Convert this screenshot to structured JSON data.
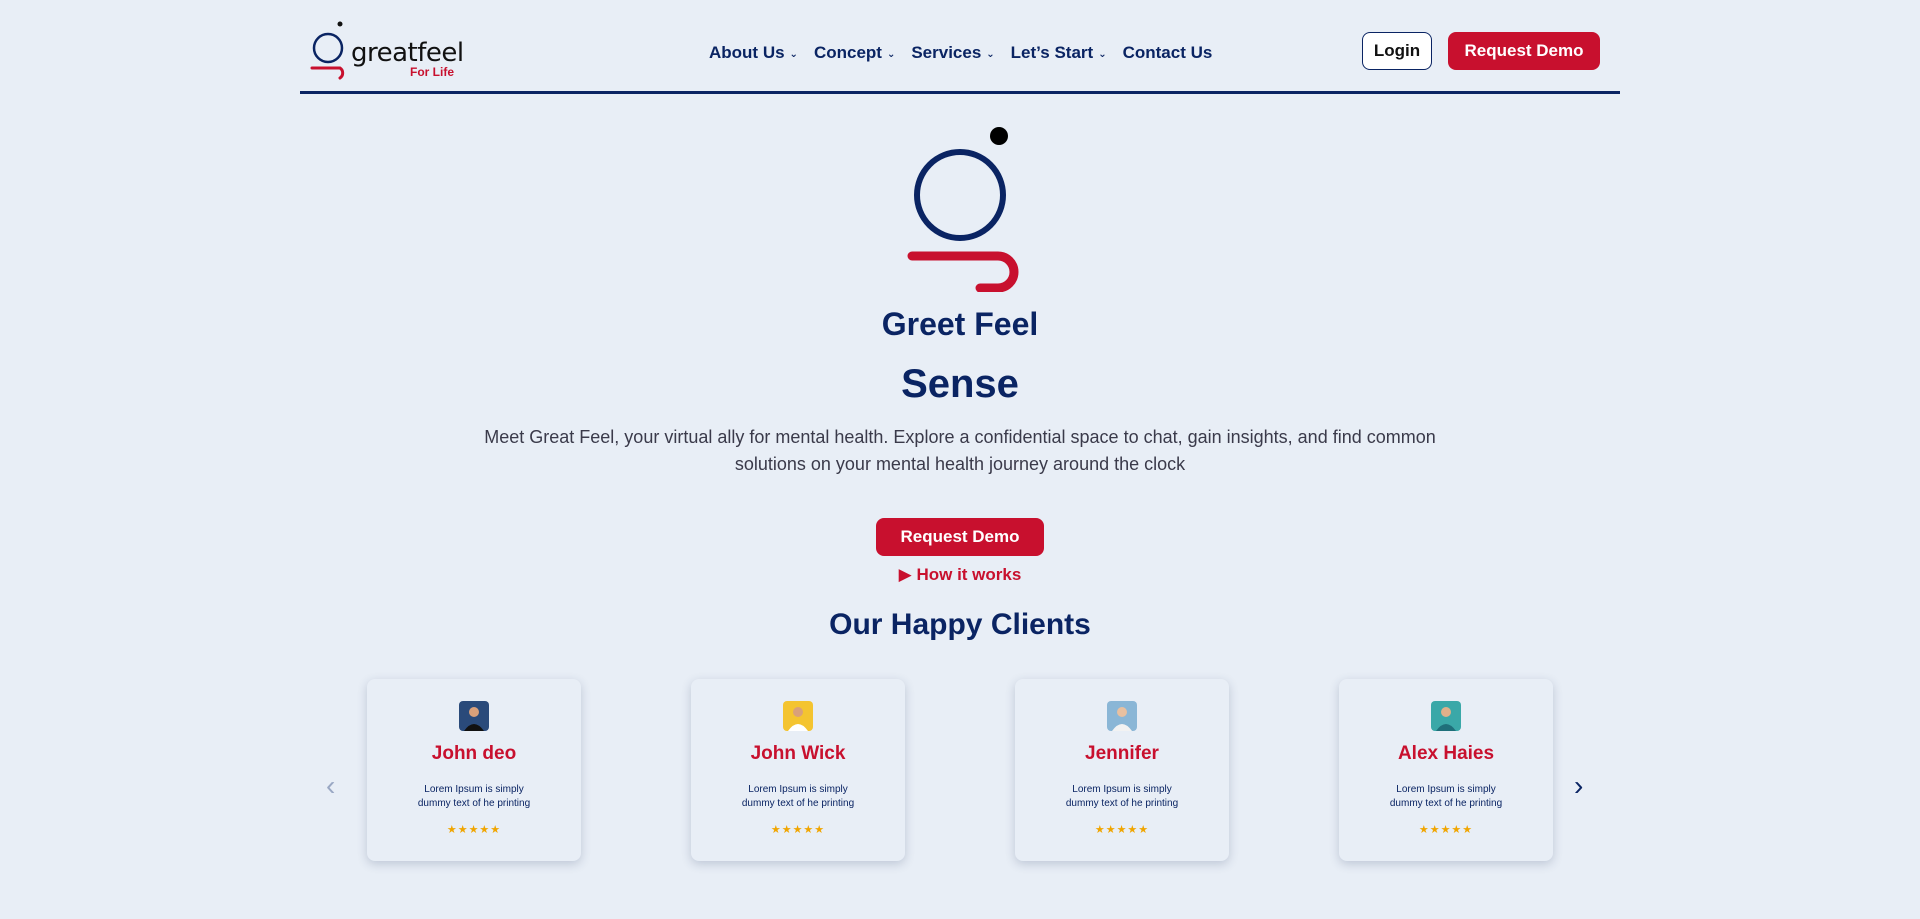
{
  "header": {
    "logo_word": "greatfeel",
    "logo_sub": "For Life",
    "nav": [
      {
        "label": "About Us",
        "has_dropdown": true
      },
      {
        "label": "Concept",
        "has_dropdown": true
      },
      {
        "label": "Services",
        "has_dropdown": true
      },
      {
        "label": "Let’s Start",
        "has_dropdown": true
      },
      {
        "label": "Contact Us",
        "has_dropdown": false
      }
    ],
    "login_label": "Login",
    "demo_label": "Request Demo"
  },
  "hero": {
    "brand_name": "Greet Feel",
    "brand_sub": "Sense",
    "description": "Meet Great Feel, your virtual ally for mental health. Explore a confidential space to chat, gain insights, and find common solutions on your mental health journey around the clock",
    "demo_label": "Request Demo",
    "how_label": "▶ How it works"
  },
  "clients": {
    "title": "Our Happy Clients",
    "prev_icon": "chevron-left-icon",
    "next_icon": "chevron-right-icon",
    "cards": [
      {
        "name": "John deo",
        "text": "Lorem Ipsum is simply dummy text of he printing",
        "stars": "★★★★★",
        "rating": 5,
        "avatar_color": "#2a4a7a"
      },
      {
        "name": "John Wick",
        "text": "Lorem Ipsum is simply dummy text of he printing",
        "stars": "★★★★★",
        "rating": 5,
        "avatar_color": "#f4c430"
      },
      {
        "name": "Jennifer",
        "text": "Lorem Ipsum is simply dummy text of he printing",
        "stars": "★★★★★",
        "rating": 5,
        "avatar_color": "#8ab6d6"
      },
      {
        "name": "Alex Haies",
        "text": "Lorem Ipsum is simply dummy text of he printing",
        "stars": "★★★★★",
        "rating": 5,
        "avatar_color": "#3aa8a8"
      }
    ]
  },
  "colors": {
    "navy": "#0a2463",
    "red": "#c8102e",
    "background": "#e8eef6",
    "star": "#f0a500"
  }
}
